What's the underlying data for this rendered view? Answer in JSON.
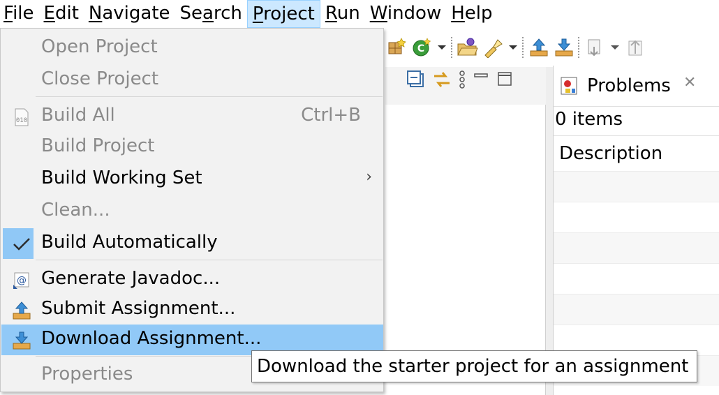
{
  "menubar": {
    "items": [
      {
        "mnemonic": "F",
        "rest": "ile"
      },
      {
        "mnemonic": "E",
        "rest": "dit"
      },
      {
        "mnemonic": "N",
        "rest": "avigate"
      },
      {
        "pre": "Se",
        "mnemonic": "a",
        "rest": "rch"
      },
      {
        "mnemonic": "P",
        "rest": "roject"
      },
      {
        "mnemonic": "R",
        "rest": "un"
      },
      {
        "mnemonic": "W",
        "rest": "indow"
      },
      {
        "mnemonic": "H",
        "rest": "elp"
      }
    ]
  },
  "project_menu": {
    "open_project": "Open Project",
    "close_project": "Close Project",
    "build_all": "Build All",
    "build_all_shortcut": "Ctrl+B",
    "build_project": "Build Project",
    "build_working_set": "Build Working Set",
    "clean": "Clean...",
    "build_automatically": "Build Automatically",
    "generate_javadoc": "Generate Javadoc...",
    "submit_assignment": "Submit Assignment...",
    "download_assignment": "Download Assignment...",
    "properties": "Properties"
  },
  "problems": {
    "tab_title": "Problems",
    "count": "0 items",
    "column_description": "Description"
  },
  "tooltip": "Download the starter project for an assignment",
  "colors": {
    "highlight": "#91c9f7",
    "menu_active": "#cce8ff",
    "disabled_text": "#8a8a8a"
  }
}
